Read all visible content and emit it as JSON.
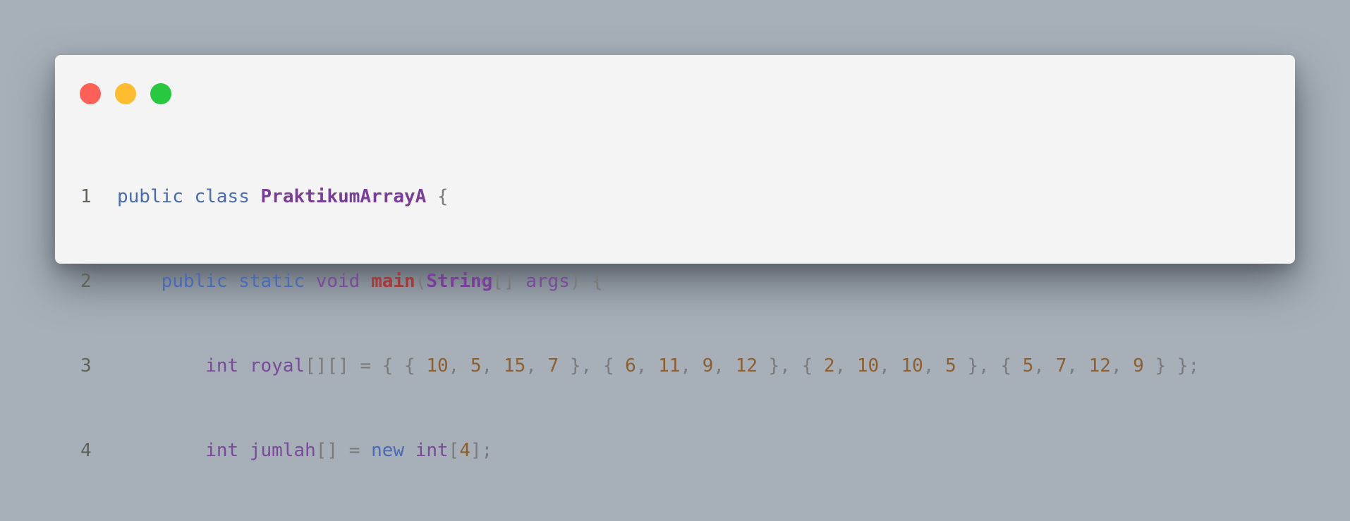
{
  "colors": {
    "background": "#a7b0b9",
    "window": "#f4f4f4",
    "close": "#fe5f57",
    "minimize": "#febc2e",
    "maximize": "#28c840",
    "keyword": "#4a6ab8",
    "type": "#7a4a9a",
    "class_name": "#7a3d9a",
    "function_name": "#a63a3a",
    "number": "#8f5e2e",
    "punctuation": "#7a7a7a"
  },
  "window_controls": [
    {
      "icon": "close-dot-icon",
      "color": "#fe5f57"
    },
    {
      "icon": "minimize-dot-icon",
      "color": "#febc2e"
    },
    {
      "icon": "maximize-dot-icon",
      "color": "#28c840"
    }
  ],
  "code": {
    "lines": [
      {
        "number": "1",
        "tokens": [
          {
            "t": "public",
            "k": "kw"
          },
          {
            "t": " ",
            "k": "punc"
          },
          {
            "t": "class",
            "k": "kw"
          },
          {
            "t": " ",
            "k": "punc"
          },
          {
            "t": "PraktikumArrayA",
            "k": "cls"
          },
          {
            "t": " {",
            "k": "punc"
          }
        ]
      },
      {
        "number": "2",
        "tokens": [
          {
            "t": "    ",
            "k": "punc"
          },
          {
            "t": "public",
            "k": "kw"
          },
          {
            "t": " ",
            "k": "punc"
          },
          {
            "t": "static",
            "k": "kw"
          },
          {
            "t": " ",
            "k": "punc"
          },
          {
            "t": "void",
            "k": "ty"
          },
          {
            "t": " ",
            "k": "punc"
          },
          {
            "t": "main",
            "k": "fn"
          },
          {
            "t": "(",
            "k": "punc"
          },
          {
            "t": "String",
            "k": "cls"
          },
          {
            "t": "[] ",
            "k": "punc"
          },
          {
            "t": "args",
            "k": "id"
          },
          {
            "t": ") {",
            "k": "punc"
          }
        ]
      },
      {
        "number": "3",
        "tokens": [
          {
            "t": "        ",
            "k": "punc"
          },
          {
            "t": "int",
            "k": "ty"
          },
          {
            "t": " ",
            "k": "punc"
          },
          {
            "t": "royal",
            "k": "id"
          },
          {
            "t": "[][] = { { ",
            "k": "punc"
          },
          {
            "t": "10",
            "k": "num"
          },
          {
            "t": ", ",
            "k": "punc"
          },
          {
            "t": "5",
            "k": "num"
          },
          {
            "t": ", ",
            "k": "punc"
          },
          {
            "t": "15",
            "k": "num"
          },
          {
            "t": ", ",
            "k": "punc"
          },
          {
            "t": "7",
            "k": "num"
          },
          {
            "t": " }, { ",
            "k": "punc"
          },
          {
            "t": "6",
            "k": "num"
          },
          {
            "t": ", ",
            "k": "punc"
          },
          {
            "t": "11",
            "k": "num"
          },
          {
            "t": ", ",
            "k": "punc"
          },
          {
            "t": "9",
            "k": "num"
          },
          {
            "t": ", ",
            "k": "punc"
          },
          {
            "t": "12",
            "k": "num"
          },
          {
            "t": " }, { ",
            "k": "punc"
          },
          {
            "t": "2",
            "k": "num"
          },
          {
            "t": ", ",
            "k": "punc"
          },
          {
            "t": "10",
            "k": "num"
          },
          {
            "t": ", ",
            "k": "punc"
          },
          {
            "t": "10",
            "k": "num"
          },
          {
            "t": ", ",
            "k": "punc"
          },
          {
            "t": "5",
            "k": "num"
          },
          {
            "t": " }, { ",
            "k": "punc"
          },
          {
            "t": "5",
            "k": "num"
          },
          {
            "t": ", ",
            "k": "punc"
          },
          {
            "t": "7",
            "k": "num"
          },
          {
            "t": ", ",
            "k": "punc"
          },
          {
            "t": "12",
            "k": "num"
          },
          {
            "t": ", ",
            "k": "punc"
          },
          {
            "t": "9",
            "k": "num"
          },
          {
            "t": " } };",
            "k": "punc"
          }
        ]
      },
      {
        "number": "4",
        "tokens": [
          {
            "t": "        ",
            "k": "punc"
          },
          {
            "t": "int",
            "k": "ty"
          },
          {
            "t": " ",
            "k": "punc"
          },
          {
            "t": "jumlah",
            "k": "id"
          },
          {
            "t": "[] = ",
            "k": "punc"
          },
          {
            "t": "new",
            "k": "kw"
          },
          {
            "t": " ",
            "k": "punc"
          },
          {
            "t": "int",
            "k": "ty"
          },
          {
            "t": "[",
            "k": "punc"
          },
          {
            "t": "4",
            "k": "num"
          },
          {
            "t": "];",
            "k": "punc"
          }
        ]
      }
    ]
  }
}
